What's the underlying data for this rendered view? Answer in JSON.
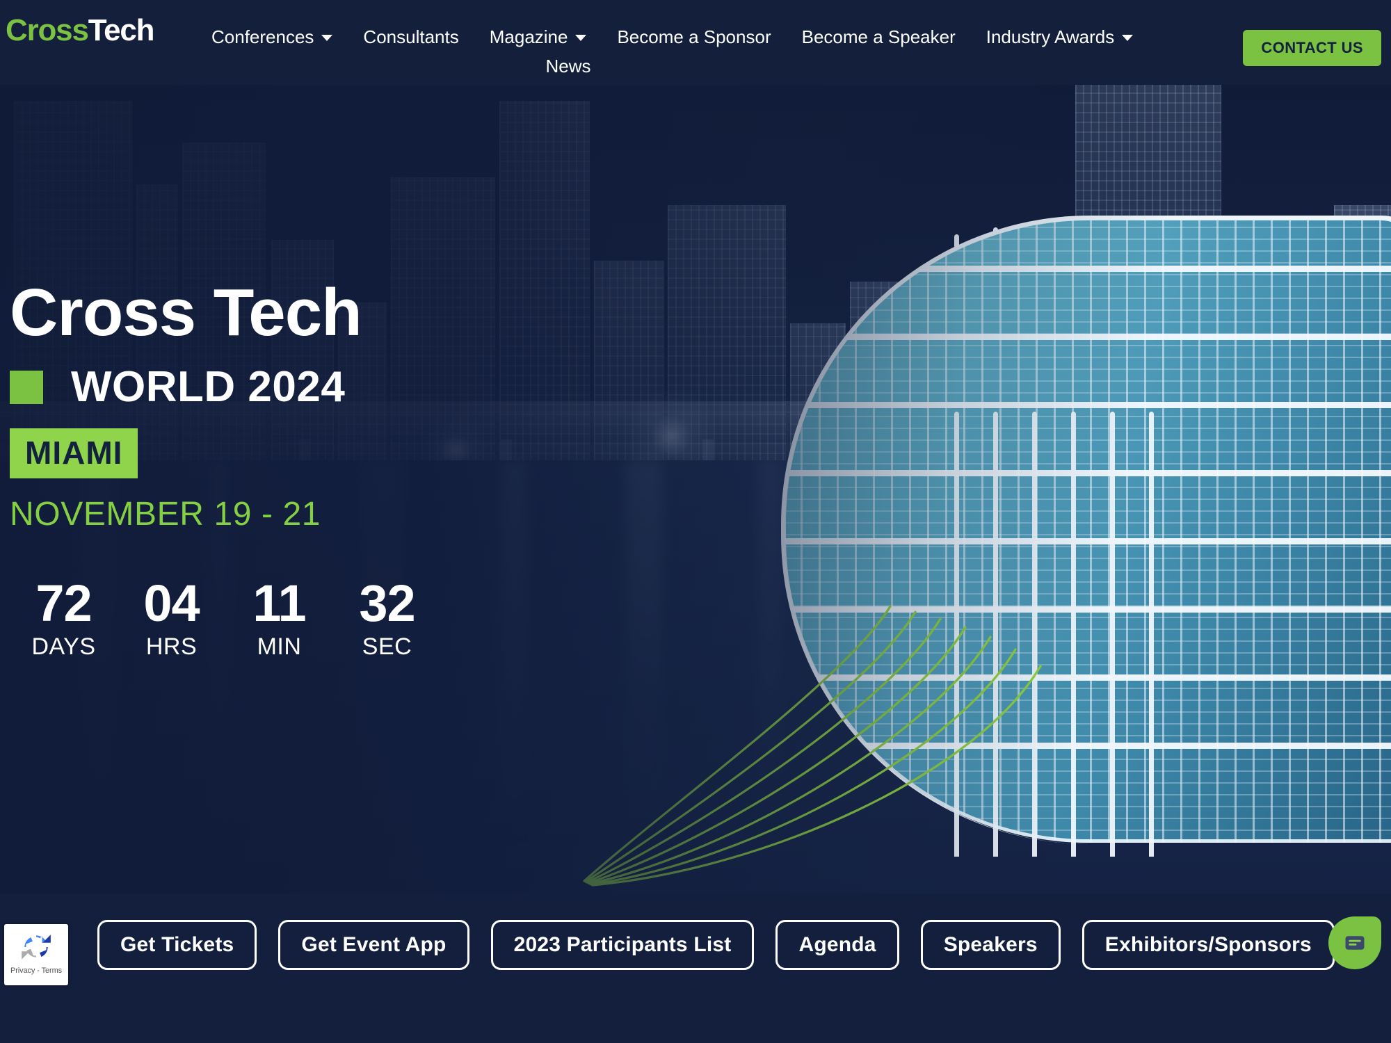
{
  "brand": {
    "name_part1": "Cross",
    "name_part2": "Tech",
    "green": "#7cc242",
    "navy": "#131f3d"
  },
  "navbar": {
    "items": [
      {
        "label": "Conferences",
        "has_caret": true
      },
      {
        "label": "Consultants",
        "has_caret": false
      },
      {
        "label": "Magazine",
        "has_caret": true
      },
      {
        "label": "Become a Sponsor",
        "has_caret": false
      },
      {
        "label": "Become a Speaker",
        "has_caret": false
      },
      {
        "label": "Industry Awards",
        "has_caret": true
      }
    ],
    "second_row": [
      {
        "label": "News",
        "has_caret": false
      }
    ],
    "cta_label": "CONTACT US"
  },
  "hero": {
    "title": "Cross Tech",
    "subtitle": "WORLD 2024",
    "city_badge": "MIAMI",
    "dates": "NOVEMBER 19 - 21",
    "countdown": [
      {
        "value": "72",
        "label": "DAYS"
      },
      {
        "value": "04",
        "label": "HRS"
      },
      {
        "value": "11",
        "label": "MIN"
      },
      {
        "value": "32",
        "label": "SEC"
      }
    ]
  },
  "bottom_bar": {
    "buttons": [
      {
        "label": "Get Tickets"
      },
      {
        "label": "Get Event App"
      },
      {
        "label": "2023 Participants List"
      },
      {
        "label": "Agenda"
      },
      {
        "label": "Speakers"
      },
      {
        "label": "Exhibitors/Sponsors"
      }
    ],
    "recaptcha_text": "Privacy - Terms",
    "chat_icon": "chat-bubble-icon"
  }
}
